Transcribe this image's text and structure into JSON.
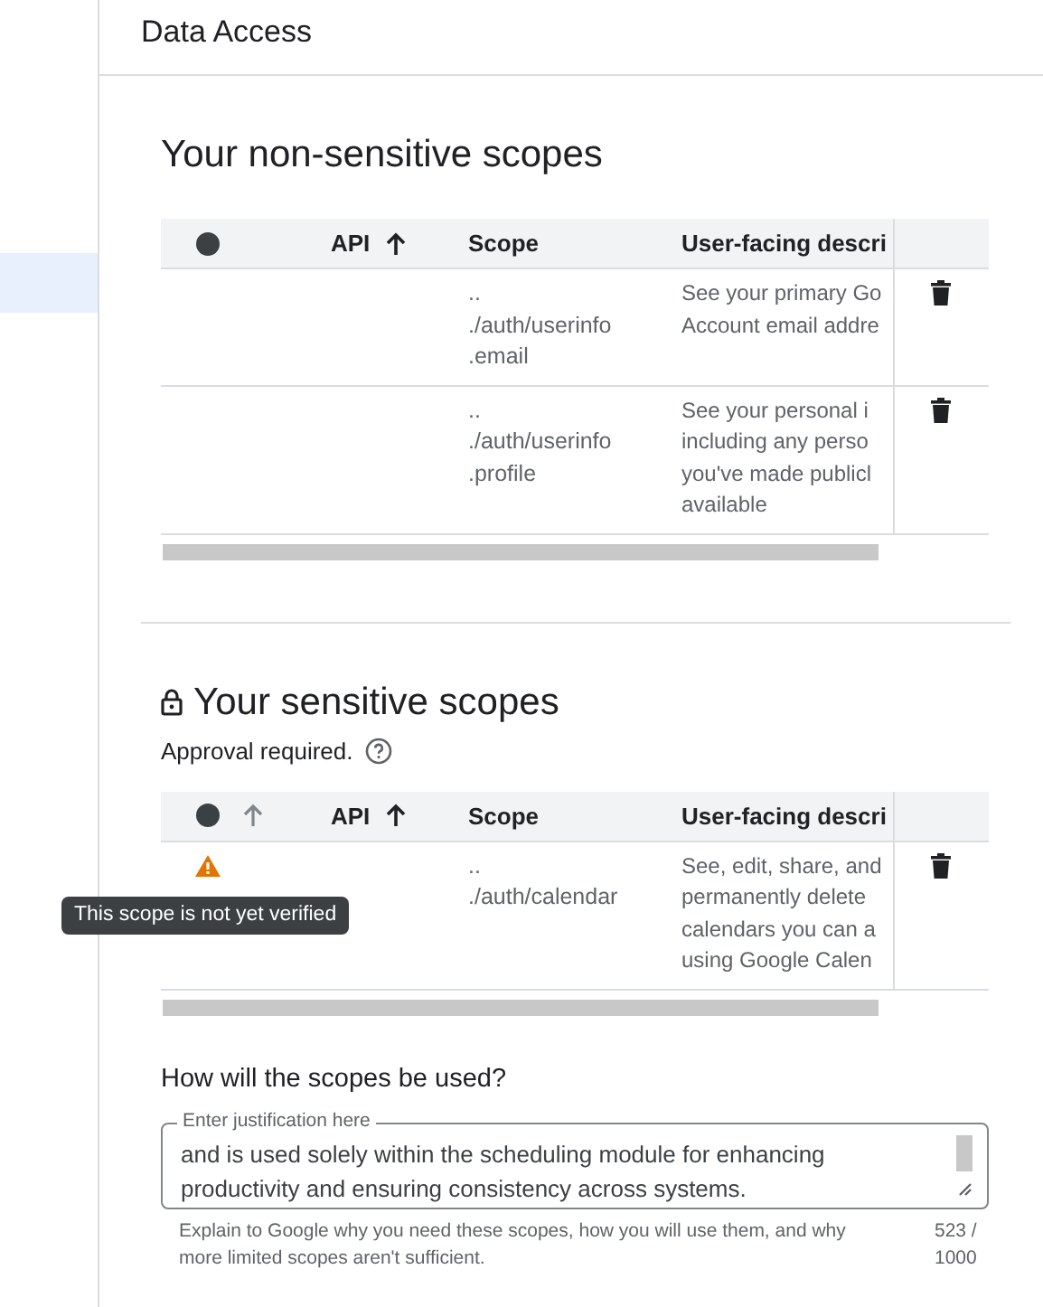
{
  "header": {
    "title": "Data Access"
  },
  "sections": [
    {
      "title": "Your non-sensitive scopes",
      "locked": false,
      "columns": [
        {
          "kind": "status",
          "sort_hint": false
        },
        {
          "label": "API",
          "sorted": true
        },
        {
          "label": "Scope",
          "sorted": false
        },
        {
          "label": "User-facing descri",
          "sorted": false
        }
      ],
      "rows": [
        {
          "unverified": false,
          "scope": [
            "..",
            "./auth/userinfo",
            ".email"
          ],
          "description": [
            "See your primary Go",
            "Account email addre"
          ]
        },
        {
          "unverified": false,
          "scope": [
            "..",
            "./auth/userinfo",
            ".profile"
          ],
          "description": [
            "See your personal i",
            "including any perso",
            "you've made publicl",
            "available"
          ]
        }
      ]
    },
    {
      "title": "Your sensitive scopes",
      "locked": true,
      "note": "Approval required.",
      "columns": [
        {
          "kind": "status",
          "sort_hint": true
        },
        {
          "label": "API",
          "sorted": true
        },
        {
          "label": "Scope",
          "sorted": false
        },
        {
          "label": "User-facing descri",
          "sorted": false
        }
      ],
      "rows": [
        {
          "unverified": true,
          "tooltip": "This scope is not yet verified",
          "scope": [
            "..",
            "./auth/calendar"
          ],
          "description": [
            "See, edit, share, and",
            "permanently delete",
            "calendars you can a",
            "using Google Calen"
          ]
        }
      ]
    }
  ],
  "justification": {
    "heading": "How will the scopes be used?",
    "label": "Enter justification here",
    "value": "and is used solely within the scheduling module for enhancing productivity and ensuring consistency across systems.",
    "helper": "Explain to Google why you need these scopes, how you will use them, and why more limited scopes aren't sufficient.",
    "counter": "523 / 1000"
  }
}
